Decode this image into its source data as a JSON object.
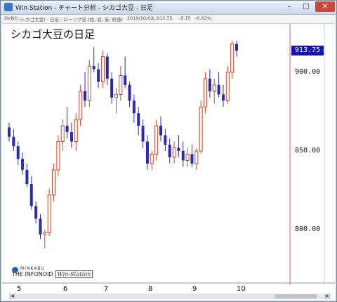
{
  "window": {
    "title": "Win-Station - チャート分析 - シカゴ大豆 - 日足",
    "min_label": "–",
    "max_label": "□",
    "close_label": "✕"
  },
  "infobar": {
    "symbol": "DVNO",
    "description": "(シカゴ大豆) - 日足 - ローソク足 (始, 高, 安, 終値)",
    "date": "2019/10/02",
    "last": "L:913.75",
    "change": "-5.75",
    "change_pct": "-0.63%"
  },
  "chart_data": {
    "type": "candlestick",
    "title": "シカゴ大豆の日足",
    "last_price_label": "913.75",
    "y_ticks": [
      "900.00",
      "850.00",
      "800.00"
    ],
    "ylim": [
      770,
      930
    ],
    "x_tick_labels": [
      "5",
      "6",
      "7",
      "8",
      "9",
      "10"
    ],
    "grid": false,
    "up_color": "#d8432a",
    "down_color": "#2a2ab4",
    "candles": [
      [
        865,
        868,
        856,
        859
      ],
      [
        859,
        864,
        850,
        853
      ],
      [
        853,
        856,
        841,
        845
      ],
      [
        845,
        849,
        835,
        838
      ],
      [
        838,
        842,
        827,
        829
      ],
      [
        829,
        834,
        813,
        815
      ],
      [
        815,
        818,
        804,
        807
      ],
      [
        807,
        810,
        794,
        797
      ],
      [
        797,
        800,
        788,
        798
      ],
      [
        798,
        826,
        796,
        822
      ],
      [
        822,
        842,
        818,
        838
      ],
      [
        838,
        860,
        834,
        856
      ],
      [
        856,
        870,
        850,
        866
      ],
      [
        866,
        878,
        858,
        862
      ],
      [
        862,
        868,
        852,
        856
      ],
      [
        856,
        874,
        850,
        870
      ],
      [
        870,
        892,
        866,
        888
      ],
      [
        888,
        900,
        878,
        882
      ],
      [
        882,
        908,
        878,
        904
      ],
      [
        904,
        916,
        900,
        902
      ],
      [
        902,
        906,
        890,
        894
      ],
      [
        894,
        914,
        890,
        910
      ],
      [
        910,
        912,
        892,
        896
      ],
      [
        896,
        900,
        880,
        884
      ],
      [
        884,
        890,
        874,
        886
      ],
      [
        886,
        904,
        882,
        898
      ],
      [
        898,
        910,
        890,
        892
      ],
      [
        892,
        894,
        878,
        882
      ],
      [
        882,
        886,
        868,
        874
      ],
      [
        874,
        878,
        860,
        866
      ],
      [
        866,
        870,
        852,
        856
      ],
      [
        856,
        860,
        838,
        842
      ],
      [
        842,
        850,
        838,
        848
      ],
      [
        848,
        870,
        844,
        866
      ],
      [
        866,
        872,
        856,
        860
      ],
      [
        860,
        864,
        850,
        854
      ],
      [
        854,
        858,
        842,
        846
      ],
      [
        846,
        856,
        842,
        852
      ],
      [
        852,
        860,
        846,
        850
      ],
      [
        850,
        856,
        840,
        844
      ],
      [
        844,
        852,
        840,
        848
      ],
      [
        848,
        854,
        840,
        842
      ],
      [
        842,
        852,
        838,
        850
      ],
      [
        850,
        882,
        848,
        878
      ],
      [
        878,
        900,
        874,
        896
      ],
      [
        896,
        902,
        884,
        888
      ],
      [
        888,
        896,
        880,
        892
      ],
      [
        892,
        900,
        884,
        886
      ],
      [
        886,
        892,
        878,
        882
      ],
      [
        882,
        904,
        880,
        900
      ],
      [
        900,
        920,
        896,
        918
      ],
      [
        918,
        920,
        910,
        913.75
      ]
    ]
  },
  "logo": {
    "top": "MINKABU",
    "bottom": "THE INFONOID",
    "product": "Win-Station"
  },
  "scrollbar": {
    "left_arrow": "◀",
    "right_arrow": "▶"
  }
}
